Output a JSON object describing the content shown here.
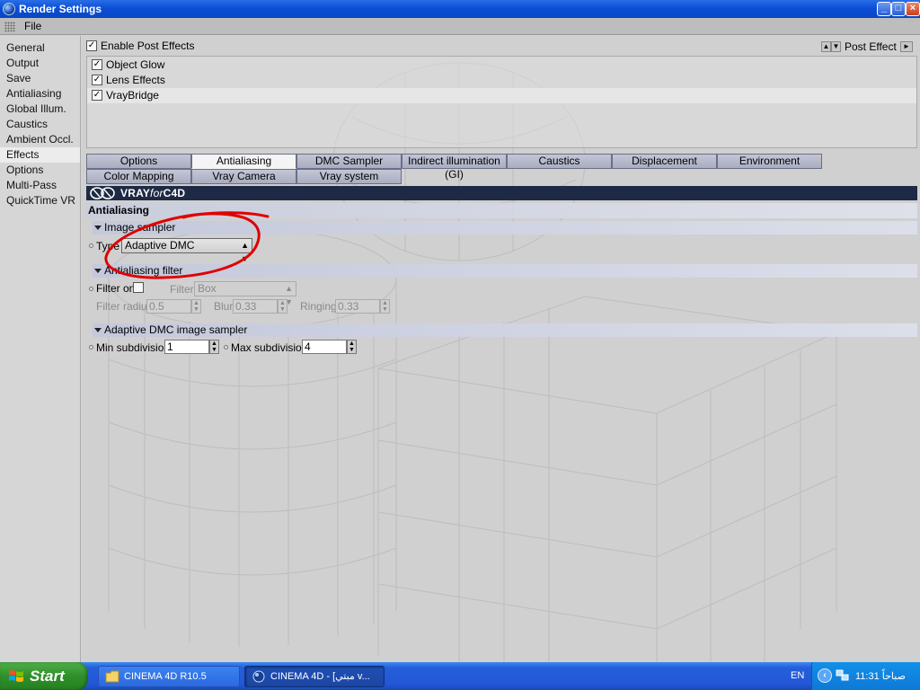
{
  "window": {
    "title": "Render Settings"
  },
  "menu": {
    "file": "File"
  },
  "sidebar": {
    "items": [
      {
        "label": "General"
      },
      {
        "label": "Output"
      },
      {
        "label": "Save"
      },
      {
        "label": "Antialiasing"
      },
      {
        "label": "Global Illum."
      },
      {
        "label": "Caustics"
      },
      {
        "label": "Ambient Occl."
      },
      {
        "label": "Effects",
        "active": true
      },
      {
        "label": "Options"
      },
      {
        "label": "Multi-Pass"
      },
      {
        "label": "QuickTime VR"
      }
    ]
  },
  "post_effects": {
    "enable_label": "Enable Post Effects",
    "enabled": true,
    "menu_label": "Post Effect",
    "items": [
      {
        "label": "Object Glow",
        "checked": true
      },
      {
        "label": "Lens Effects",
        "checked": true
      },
      {
        "label": "VrayBridge",
        "checked": true,
        "selected": true
      }
    ]
  },
  "tabs": {
    "row1": [
      "Options",
      "Antialiasing",
      "DMC Sampler",
      "Indirect illumination (GI)",
      "Caustics",
      "Displacement",
      "Environment"
    ],
    "row2": [
      "Color Mapping",
      "Vray Camera",
      "Vray system"
    ],
    "active": "Antialiasing"
  },
  "banner": {
    "brand_a": "VRAY",
    "brand_b": "for",
    "brand_c": "C4D"
  },
  "section": {
    "title": "Antialiasing",
    "image_sampler": {
      "header": "Image sampler",
      "type_label": "Type",
      "type_value": "Adaptive DMC"
    },
    "aa_filter": {
      "header": "Antialiasing filter",
      "filter_on_label": "Filter on",
      "filter_on": false,
      "filter_label": "Filter",
      "filter_value": "Box",
      "filter_radius_label": "Filter radius",
      "filter_radius_value": "0.5",
      "blur_label": "Blur",
      "blur_value": "0.33",
      "ringing_label": "Ringing",
      "ringing_value": "0.33"
    },
    "adaptive_dmc": {
      "header": "Adaptive DMC image sampler",
      "min_label": "Min subdivision",
      "min_value": "1",
      "max_label": "Max subdivision",
      "max_value": "4"
    }
  },
  "annotation": {
    "color": "#e00000"
  },
  "taskbar": {
    "start": "Start",
    "tasks": [
      {
        "label": "CINEMA 4D R10.5",
        "icon": "folder-icon"
      },
      {
        "label": "CINEMA 4D - [مبتي v...",
        "icon": "cinema4d-icon",
        "active": true
      }
    ],
    "lang": "EN",
    "clock": "11:31 صباحاً"
  }
}
